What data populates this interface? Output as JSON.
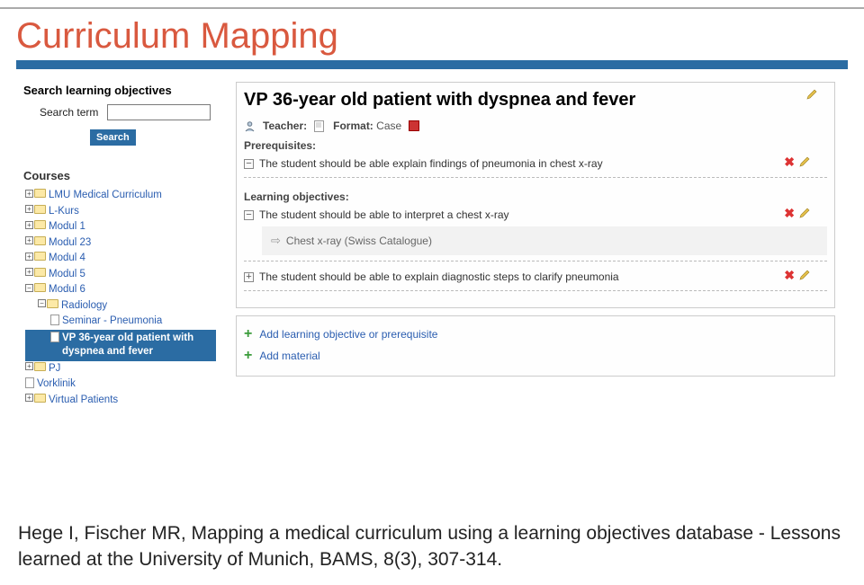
{
  "slide_title": "Curriculum Mapping",
  "sidebar": {
    "search_heading": "Search learning objectives",
    "search_label": "Search term",
    "search_placeholder": "",
    "search_button": "Search",
    "courses_heading": "Courses",
    "tree": [
      {
        "label": "LMU Medical Curriculum",
        "indent": 0,
        "box": "+",
        "folder": true
      },
      {
        "label": "L-Kurs",
        "indent": 0,
        "box": "+",
        "folder": true
      },
      {
        "label": "Modul 1",
        "indent": 0,
        "box": "+",
        "folder": true
      },
      {
        "label": "Modul 23",
        "indent": 0,
        "box": "+",
        "folder": true
      },
      {
        "label": "Modul 4",
        "indent": 0,
        "box": "+",
        "folder": true
      },
      {
        "label": "Modul 5",
        "indent": 0,
        "box": "+",
        "folder": true
      },
      {
        "label": "Modul 6",
        "indent": 0,
        "box": "−",
        "folder": true
      },
      {
        "label": "Radiology",
        "indent": 1,
        "box": "−",
        "folder": true
      },
      {
        "label": "Seminar - Pneumonia",
        "indent": 2,
        "box": "",
        "folder": false
      },
      {
        "label": "VP 36-year old patient with dyspnea and fever",
        "indent": 2,
        "box": "",
        "folder": false,
        "selected": true
      },
      {
        "label": "PJ",
        "indent": 0,
        "box": "+",
        "folder": true
      },
      {
        "label": "Vorklinik",
        "indent": 0,
        "box": "",
        "folder": false
      },
      {
        "label": "Virtual Patients",
        "indent": 0,
        "box": "+",
        "folder": true
      }
    ]
  },
  "main": {
    "case_title": "VP 36-year old patient with dyspnea and fever",
    "teacher_label": "Teacher:",
    "format_label": "Format:",
    "format_value": "Case",
    "prereq_heading": "Prerequisites:",
    "prereq_items": [
      {
        "expander": "−",
        "text": "The student should be able explain findings of pneumonia in chest x-ray"
      }
    ],
    "lo_heading": "Learning objectives:",
    "lo_items": [
      {
        "expander": "−",
        "text": "The student should be able to interpret a chest x-ray",
        "sub": {
          "text": "Chest x-ray (Swiss Catalogue)"
        }
      },
      {
        "expander": "+",
        "text": "The student should be able to explain diagnostic steps to clarify pneumonia"
      }
    ],
    "add_lo_label": "Add learning objective or prerequisite",
    "add_material_label": "Add material"
  },
  "citation": "Hege I, Fischer MR, Mapping a medical curriculum using a learning objectives database - Lessons learned at the University of Munich, BAMS, 8(3), 307-314."
}
